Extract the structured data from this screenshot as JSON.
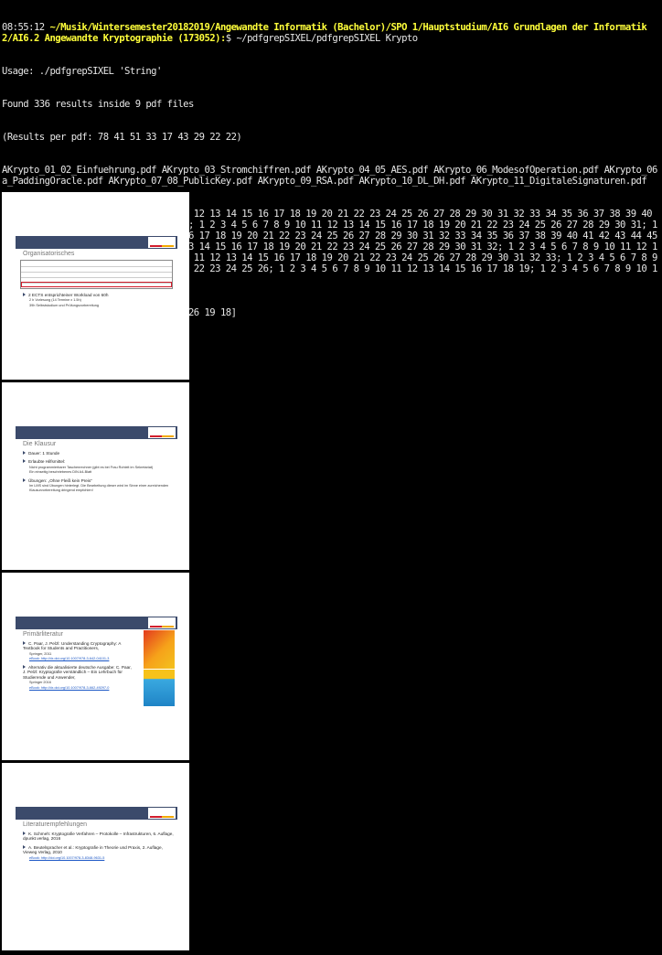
{
  "terminal": {
    "prompt_time": "08:55:12",
    "prompt_path": "~/Musik/Wintersemester20182019/Angewandte Informatik (Bachelor)/SPO 1/Hauptstudium/AI6 Grundlagen der Informatik 2/AI6.2 Angewandte Kryptographie (173052):",
    "prompt_symbol": "$",
    "command": "~/pdfgrepSIXEL/pdfgrepSIXEL Krypto",
    "usage": "Usage: ./pdfgrepSIXEL 'String'",
    "found": "Found 336 results inside 9 pdf files",
    "results_per_pdf": "(Results per pdf: 78 41 51 33 17 43 29 22 22)",
    "files": "AKrypto_01_02_Einfuehrung.pdf AKrypto_03_Stromchiffren.pdf AKrypto_04_05_AES.pdf AKrypto_06_ModesofOperation.pdf AKrypto_06a_PaddingOracle.pdf AKrypto_07_08_PublicKey.pdf AKrypto_09_RSA.pdf AKrypto_10_DL_DH.pdf AKrypto_11_DigitaleSignaturen.pdf",
    "pages": "Pages:  274 ( 2 3 4 5 6 7 8 9 10 11 12 13 14 15 16 17 18 19 20 21 22 23 24 25 26 27 28 29 30 31 32 33 34 35 36 37 38 39 40 41 42 43 44 45 46 47 48 49 50 51 52; 1 2 3 4 5 6 7 8 9 10 11 12 13 14 15 16 17 18 19 20 21 22 23 24 25 26 27 28 29 30 31; 1 2 3 4 5 6 7 8 9 10 11 12 13 14 15 16 17 18 19 20 21 22 23 24 25 26 27 28 29 30 31 32 33 34 35 36 37 38 39 40 41 42 43 44 45 46 47; 1 2 3 4 5 6 7 8 9 10 11 12 13 14 15 16 17 18 19 20 21 22 23 24 25 26 27 28 29 30 31 32; 1 2 3 4 5 6 7 8 9 10 11 12 13 14 15 16 17; 1 2 3 4 5 6 7 8 9 10 11 12 13 14 15 16 17 18 19 20 21 22 23 24 25 26 27 28 29 30 31 32 33; 1 2 3 4 5 6 7 8 9 10 11 12 13 14 15 16 17 18 19 20 21 22 23 24 25 26; 1 2 3 4 5 6 7 8 9 10 11 12 13 14 15 16 17 18 19; 1 2 3 4 5 6 7 8 9 10 11 12 13 14 15 16 17 18 )",
    "pages_per_pdf": "[Pages per pdf:  51 31 47 32 17 33 26 19 18]"
  },
  "colors": {
    "prompt": "#ffff3a",
    "text": "#e6e6e6",
    "slide_bar": "#3b4a6b",
    "accent_red": "#d21d2c",
    "link": "#1a56c5"
  },
  "thumbs": [
    {
      "header": "Organisatorisches",
      "bullets": [
        {
          "text": "2 ECTS entsprichteiner Workload von 60h",
          "subs": [
            "2 h Vorlesung (14 Termine x 1.5h)",
            "39h Selbststudium und Prüfungsvorbereitung"
          ]
        }
      ]
    },
    {
      "header": "Die Klausur",
      "bullets": [
        {
          "text": "Dauer: 1 Stunde",
          "subs": []
        },
        {
          "text": "Erlaubte Hilfsmittel:",
          "subs": [
            "Nicht programmierbarer Taschenrechner (gibt es bei Frau Rohleit im Sekretariat)",
            "Ein einseitig beschriebenes DIN A4-Blatt"
          ]
        },
        {
          "text": "Übungen: „Ohne Fleiß kein Preis“",
          "subs": [
            "Im LMS sind Übungen hinterlegt. Die Bearbeitung dieser wird im Sinne einer zureichenden Klausurvorbereitung dringend empfohlen!"
          ]
        }
      ]
    },
    {
      "header": "Primärliteratur",
      "bullets": [
        {
          "text": "C. Paar, J. Pelzl: Understanding Cryptography: A Textbook for Students and Practitioners,",
          "subs": [
            "Springer, 2011",
            "eBook: http://dx.doi.org/10.1007/978-3-642-04101-3"
          ]
        },
        {
          "text": "Alternativ die aktualisierte deutsche Ausgabe: C. Paar, J. Pelzl: Kryptografie verständlich – Ein Lehrbuch für Studierende und Anwender,",
          "subs": [
            "Springer 2016",
            "eBook: http://dx.doi.org/10.1007/978-3-662-49297-0"
          ]
        }
      ]
    },
    {
      "header": "Literaturempfehlungen",
      "bullets": [
        {
          "text": "K. Schmeh: Kryptografie Verfahren – Protokolle – Infrastrukturen, 6. Auflage, dpunkt.verlag, 2016",
          "subs": []
        },
        {
          "text": "A. Beutelspracher et al.: Kryptografie in Theorie und Praxis, 2. Auflage, Vieweg Verlag, 2010",
          "subs": [
            "eBook: http://doi.org/10.1007/978-3-8348-9631-5"
          ]
        }
      ]
    }
  ]
}
